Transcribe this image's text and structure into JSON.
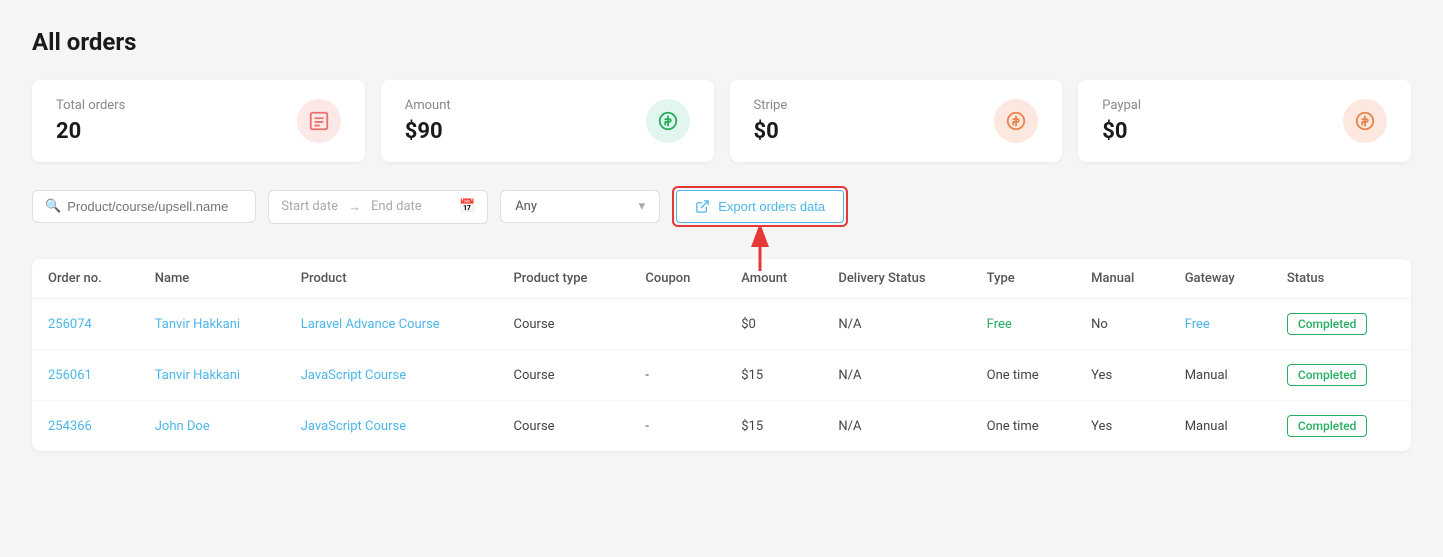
{
  "page": {
    "title": "All orders"
  },
  "stats": [
    {
      "id": "total-orders",
      "label": "Total orders",
      "value": "20",
      "icon": "📋",
      "iconClass": "pink"
    },
    {
      "id": "amount",
      "label": "Amount",
      "value": "$90",
      "icon": "💲",
      "iconClass": "green"
    },
    {
      "id": "stripe",
      "label": "Stripe",
      "value": "$0",
      "icon": "💰",
      "iconClass": "orange"
    },
    {
      "id": "paypal",
      "label": "Paypal",
      "value": "$0",
      "icon": "💰",
      "iconClass": "orange"
    }
  ],
  "filters": {
    "search_placeholder": "Product/course/upsell.name",
    "start_date_placeholder": "Start date",
    "end_date_placeholder": "End date",
    "dropdown_value": "Any",
    "export_label": "Export orders data"
  },
  "table": {
    "columns": [
      "Order no.",
      "Name",
      "Product",
      "Product type",
      "Coupon",
      "Amount",
      "Delivery Status",
      "Type",
      "Manual",
      "Gateway",
      "Status"
    ],
    "rows": [
      {
        "order_no": "256074",
        "name": "Tanvir Hakkani",
        "product": "Laravel Advance Course",
        "product_type": "Course",
        "coupon": "",
        "amount": "$0",
        "delivery_status": "N/A",
        "type": "Free",
        "manual": "No",
        "gateway": "Free",
        "status": "Completed"
      },
      {
        "order_no": "256061",
        "name": "Tanvir Hakkani",
        "product": "JavaScript Course",
        "product_type": "Course",
        "coupon": "-",
        "amount": "$15",
        "delivery_status": "N/A",
        "type": "One time",
        "manual": "Yes",
        "gateway": "Manual",
        "status": "Completed"
      },
      {
        "order_no": "254366",
        "name": "John Doe",
        "product": "JavaScript Course",
        "product_type": "Course",
        "coupon": "-",
        "amount": "$15",
        "delivery_status": "N/A",
        "type": "One time",
        "manual": "Yes",
        "gateway": "Manual",
        "status": "Completed"
      }
    ]
  },
  "colors": {
    "accent_blue": "#4db6e8",
    "accent_green": "#27ae60",
    "accent_red": "#e53935"
  }
}
